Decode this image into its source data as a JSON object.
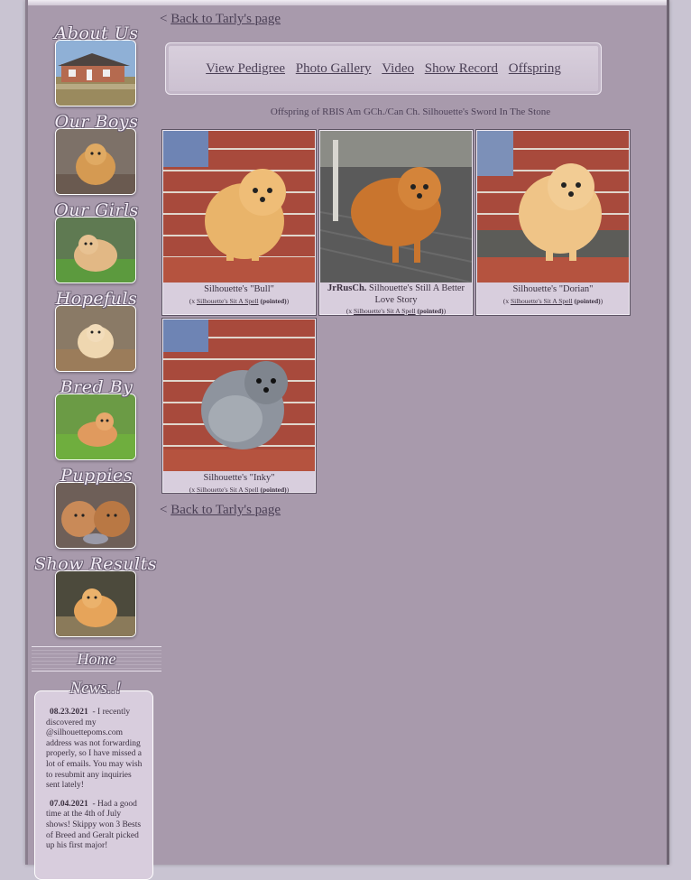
{
  "sidebar": {
    "items": [
      {
        "label": "About Us"
      },
      {
        "label": "Our Boys"
      },
      {
        "label": "Our Girls"
      },
      {
        "label": "Hopefuls"
      },
      {
        "label": "Bred By"
      },
      {
        "label": "Puppies"
      },
      {
        "label": "Show Results"
      }
    ],
    "home": "Home",
    "news_title": "News..!",
    "news": [
      {
        "date": "08.23.2021",
        "text": "- I recently discovered my @silhouettepoms.com address was not forwarding properly, so I have missed a lot of emails. You may wish to resubmit any inquiries sent lately!"
      },
      {
        "date": "07.04.2021",
        "pre": "- Had a good time at the 4th of July shows! ",
        "link1": "Skippy",
        "mid": " won 3 Bests of Breed and ",
        "link2": "Geralt",
        "post": " picked up his first major!"
      }
    ]
  },
  "main": {
    "back_top": "Back to Tarly's page",
    "back_bottom": "Back to Tarly's page",
    "back_prefix": "<",
    "menu": [
      "View Pedigree",
      "Photo Gallery",
      "Video",
      "Show Record",
      "Offspring"
    ],
    "heading": "Offspring of RBIS Am GCh./Can Ch. Silhouette's Sword In The Stone",
    "offspring": [
      {
        "title_prefix": "",
        "name": "Silhouette's \"Bull\"",
        "sire_pre": "(x ",
        "sire": "Silhouette's Sit A Spell",
        "status": "(pointed)",
        "sire_post": ")"
      },
      {
        "title_prefix": "JrRusCh.",
        "name": " Silhouette's Still A Better Love Story",
        "sire_pre": "(x ",
        "sire": "Silhouette's Sit A Spell",
        "status": "(pointed)",
        "sire_post": ")"
      },
      {
        "title_prefix": "",
        "name": "Silhouette's \"Dorian\"",
        "sire_pre": "(x ",
        "sire": "Silhouette's Sit A Spell",
        "status": "(pointed)",
        "sire_post": ")"
      },
      {
        "title_prefix": "",
        "name": "Silhouette's \"Inky\"",
        "sire_pre": "(x ",
        "sire": "Silhouette's Sit A Spell",
        "status": "(pointed)",
        "sire_post": ")"
      }
    ]
  }
}
